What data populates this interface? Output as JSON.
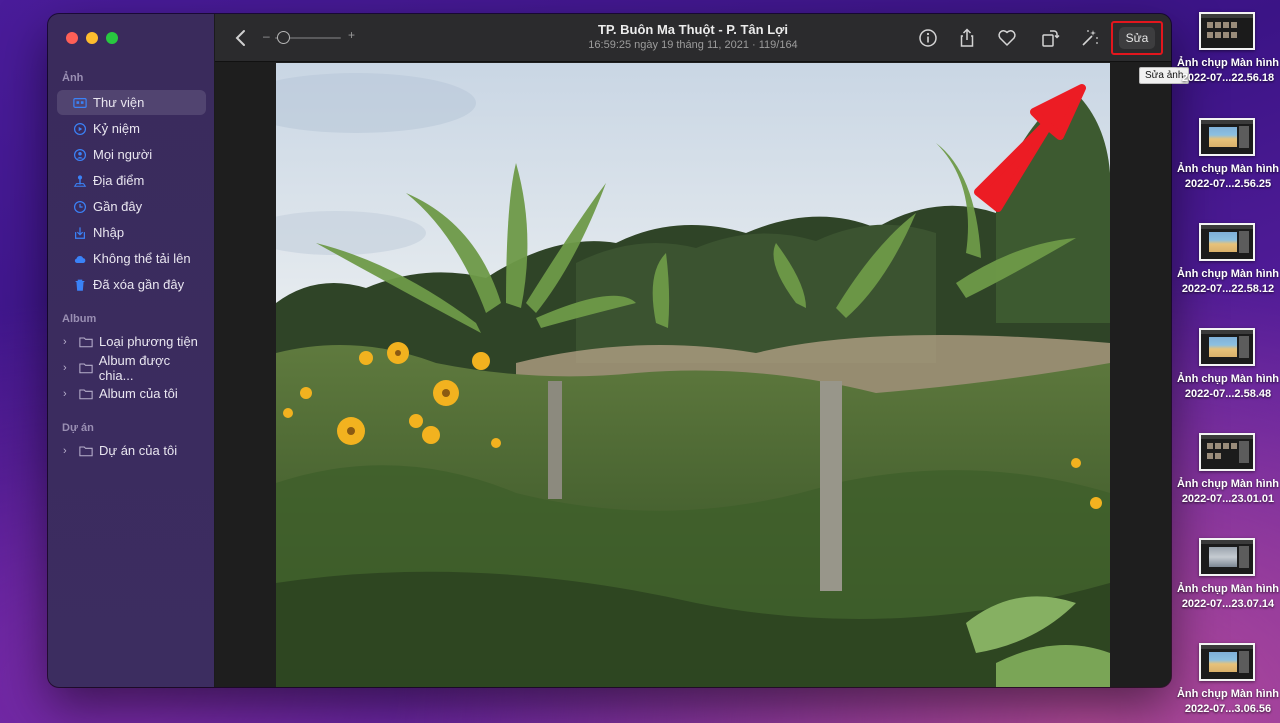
{
  "sidebar": {
    "sections": {
      "photos": "Ảnh",
      "album": "Album",
      "projects": "Dự án"
    },
    "items": [
      {
        "label": "Thư viện",
        "icon": "library-icon"
      },
      {
        "label": "Kỷ niệm",
        "icon": "memories-icon"
      },
      {
        "label": "Mọi người",
        "icon": "people-icon"
      },
      {
        "label": "Địa điểm",
        "icon": "places-icon"
      },
      {
        "label": "Gần đây",
        "icon": "recents-icon"
      },
      {
        "label": "Nhập",
        "icon": "import-icon"
      },
      {
        "label": "Không thể tải lên",
        "icon": "cloud-icon"
      },
      {
        "label": "Đã xóa gần đây",
        "icon": "trash-icon"
      }
    ],
    "album_items": [
      {
        "label": "Loại phương tiện"
      },
      {
        "label": "Album được chia..."
      },
      {
        "label": "Album của tôi"
      }
    ],
    "project_items": [
      {
        "label": "Dự án của tôi"
      }
    ]
  },
  "toolbar": {
    "title": "TP. Buôn Ma Thuột - P. Tân Lợi",
    "subtitle": "16:59:25 ngày 19 tháng 11, 2021 · 119/164",
    "zoom_minus": "–",
    "zoom_plus": "+",
    "edit_label": "Sửa"
  },
  "tooltip": "Sửa ảnh",
  "desktop": {
    "files": [
      {
        "line1": "Ảnh chụp Màn hình",
        "line2": "2022-07...22.56.18"
      },
      {
        "line1": "Ảnh chụp Màn hình",
        "line2": "2022-07...2.56.25"
      },
      {
        "line1": "Ảnh chụp Màn hình",
        "line2": "2022-07...22.58.12"
      },
      {
        "line1": "Ảnh chụp Màn hình",
        "line2": "2022-07...2.58.48"
      },
      {
        "line1": "Ảnh chụp Màn hình",
        "line2": "2022-07...23.01.01"
      },
      {
        "line1": "Ảnh chụp Màn hình",
        "line2": "2022-07...23.07.14"
      },
      {
        "line1": "Ảnh chụp Màn hình",
        "line2": "2022-07...3.06.56"
      }
    ]
  },
  "colors": {
    "accent": "#3a82f7",
    "highlight_box": "#e3161d",
    "arrow": "#ec1c24"
  }
}
